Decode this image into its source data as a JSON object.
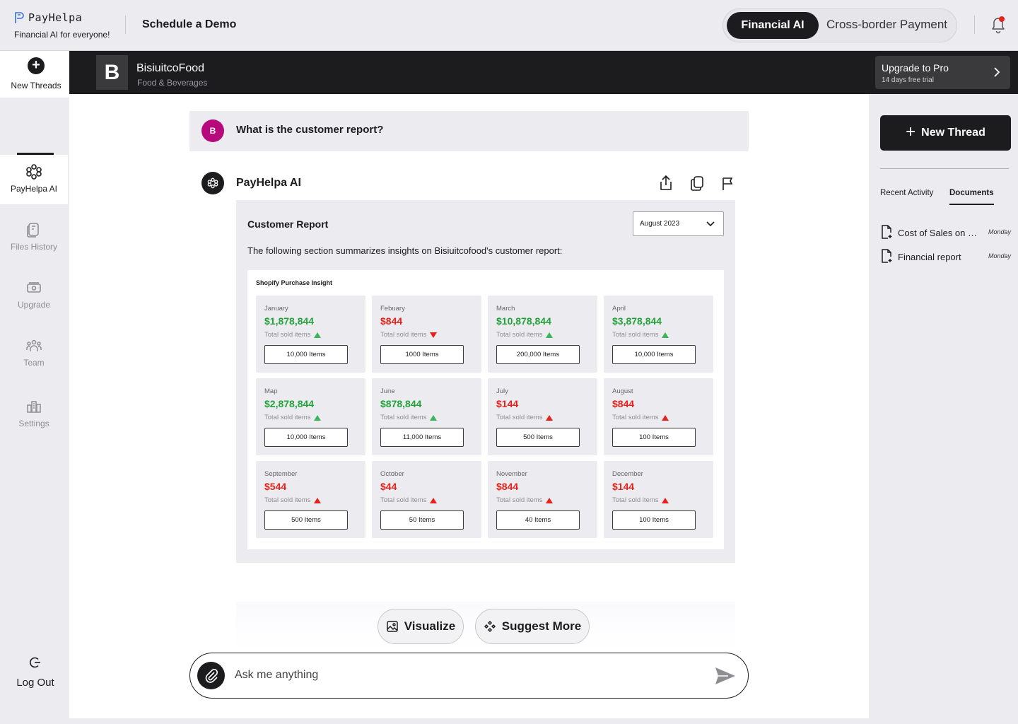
{
  "header": {
    "logo_name": "PayHelpa",
    "logo_tagline": "Financial AI for everyone!",
    "schedule_label": "Schedule a Demo",
    "modes": [
      "Financial AI",
      "Cross-border Payment"
    ]
  },
  "rail": {
    "new_threads": "New Threads",
    "items": [
      {
        "label": "PayHelpa AI",
        "icon": "payhelpa-ai-icon",
        "active": true
      },
      {
        "label": "Files History",
        "icon": "files-history-icon"
      },
      {
        "label": "Upgrade",
        "icon": "upgrade-icon"
      },
      {
        "label": "Team",
        "icon": "team-icon"
      },
      {
        "label": "Settings",
        "icon": "settings-icon"
      }
    ],
    "logout": "Log Out"
  },
  "company": {
    "initial": "B",
    "name": "BisiuitcoFood",
    "category": "Food & Beverages"
  },
  "upgrade": {
    "title": "Upgrade to Pro",
    "subtitle": "14 days free trial"
  },
  "chat": {
    "user_initial": "B",
    "question": "What is the customer report?",
    "ai_name": "PayHelpa AI",
    "report_title": "Customer Report",
    "month_selected": "August 2023",
    "report_desc": "The following section summarizes insights on Bisiuitcofood's customer report:",
    "insight_title": "Shopify Purchase Insight",
    "sold_label": "Total sold items",
    "months": [
      {
        "month": "January",
        "amount": "$1,878,844",
        "trend": "up",
        "color": "green",
        "items": "10,000 Items"
      },
      {
        "month": "Febuary",
        "amount": "$844",
        "trend": "down",
        "color": "red",
        "items": "1000 Items"
      },
      {
        "month": "March",
        "amount": "$10,878,844",
        "trend": "up",
        "color": "green",
        "items": "200,000 Items"
      },
      {
        "month": "April",
        "amount": "$3,878,844",
        "trend": "up",
        "color": "green",
        "items": "10,000 Items"
      },
      {
        "month": "Map",
        "amount": "$2,878,844",
        "trend": "up",
        "color": "green",
        "items": "10,000 Items"
      },
      {
        "month": "June",
        "amount": "$878,844",
        "trend": "up",
        "color": "green",
        "items": "11,000 Items"
      },
      {
        "month": "July",
        "amount": "$144",
        "trend": "up",
        "color": "red",
        "items": "500 Items"
      },
      {
        "month": "August",
        "amount": "$844",
        "trend": "up",
        "color": "red",
        "items": "100 Items"
      },
      {
        "month": "September",
        "amount": "$544",
        "trend": "up",
        "color": "red",
        "items": "500 Items"
      },
      {
        "month": "October",
        "amount": "$44",
        "trend": "up",
        "color": "red",
        "items": "50 Items"
      },
      {
        "month": "November",
        "amount": "$844",
        "trend": "up",
        "color": "red",
        "items": "40 Items"
      },
      {
        "month": "December",
        "amount": "$144",
        "trend": "up",
        "color": "red",
        "items": "100 Items"
      }
    ],
    "visualize_label": "Visualize",
    "suggest_label": "Suggest More",
    "input_placeholder": "Ask me anything"
  },
  "right_panel": {
    "new_thread": "New Thread",
    "tabs": [
      "Recent Activity",
      "Documents"
    ],
    "active_tab": "Documents",
    "documents": [
      {
        "name": "Cost of Sales on ot...",
        "date": "Monday"
      },
      {
        "name": "Financial report",
        "date": "Monday"
      }
    ]
  },
  "colors": {
    "positive": "#23a33a",
    "negative": "#e5221b",
    "avatar": "#b5097c",
    "dark": "#1c1c1e"
  }
}
